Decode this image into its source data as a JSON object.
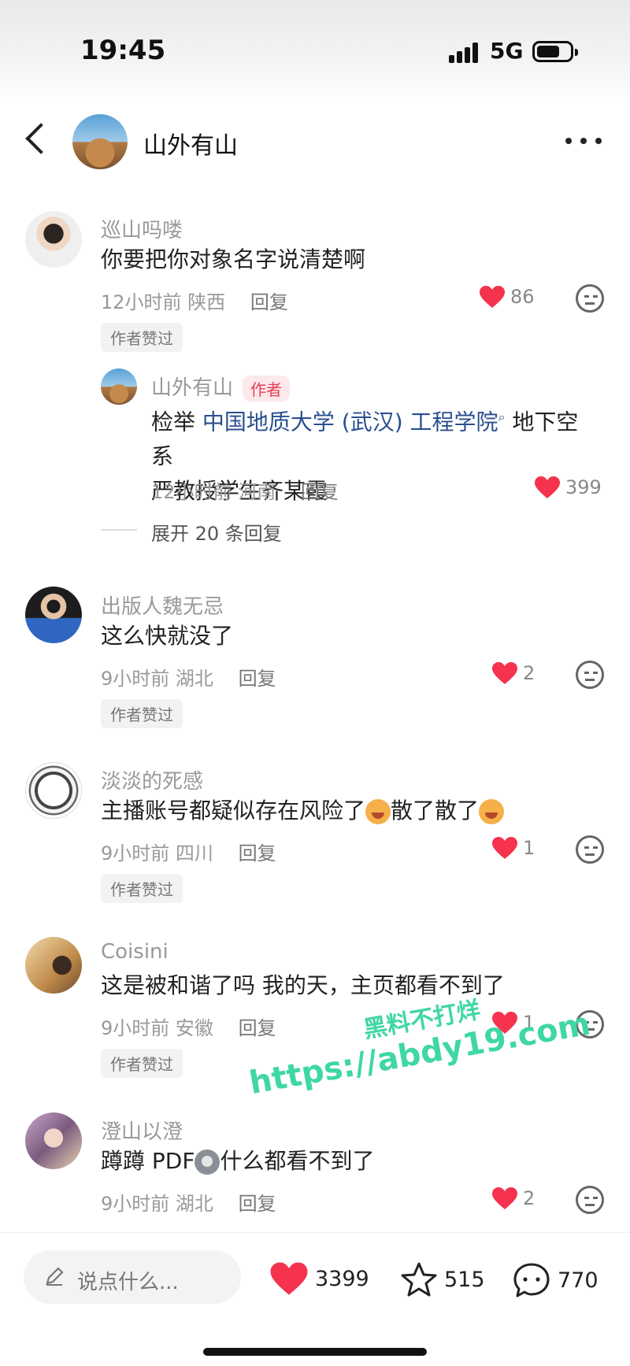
{
  "status_bar": {
    "time": "19:45",
    "network": "5G"
  },
  "header": {
    "title": "山外有山"
  },
  "comments": [
    {
      "name": "巡山吗喽",
      "text": "你要把你对象名字说清楚啊",
      "time": "12小时前",
      "location": "陕西",
      "reply": "回复",
      "likes": "86",
      "author_liked": "作者赞过",
      "sub_reply": {
        "name": "山外有山",
        "author_tag": "作者",
        "text_prefix": "检举 ",
        "link": "中国地质大学 (武汉) 工程学院",
        "text_line1_suffix": " 地下空系",
        "text_line2": "严教授学生齐某霞",
        "time": "12小时前",
        "location": "河南",
        "reply": "回复",
        "likes": "399"
      },
      "expand": "展开 20 条回复"
    },
    {
      "name": "出版人魏无忌",
      "text": "这么快就没了",
      "time": "9小时前",
      "location": "湖北",
      "reply": "回复",
      "likes": "2",
      "author_liked": "作者赞过"
    },
    {
      "name": "淡淡的死感",
      "text_a": "主播账号都疑似存在风险了",
      "text_b": "散了散了",
      "time": "9小时前",
      "location": "四川",
      "reply": "回复",
      "likes": "1",
      "author_liked": "作者赞过"
    },
    {
      "name": "Coisini",
      "text": "这是被和谐了吗 我的天，主页都看不到了",
      "time": "9小时前",
      "location": "安徽",
      "reply": "回复",
      "likes": "1",
      "author_liked": "作者赞过"
    },
    {
      "name": "澄山以澄",
      "text_a": "蹲蹲 PDF",
      "text_b": "什么都看不到了",
      "time": "9小时前",
      "location": "湖北",
      "reply": "回复",
      "likes": "2"
    }
  ],
  "watermark": {
    "line1": "黑料不打烊",
    "line2": "https://abdy19.com"
  },
  "bottom_bar": {
    "input_placeholder": "说点什么...",
    "likes": "3399",
    "favorites": "515",
    "comments": "770"
  },
  "colors": {
    "heart": "#f5334e",
    "link": "#2a4f8f",
    "author_tag": "#e63d55"
  },
  "icons": [
    "back-icon",
    "more-icon",
    "heart-icon",
    "dislike-icon",
    "pencil-icon",
    "star-icon",
    "comment-icon"
  ]
}
